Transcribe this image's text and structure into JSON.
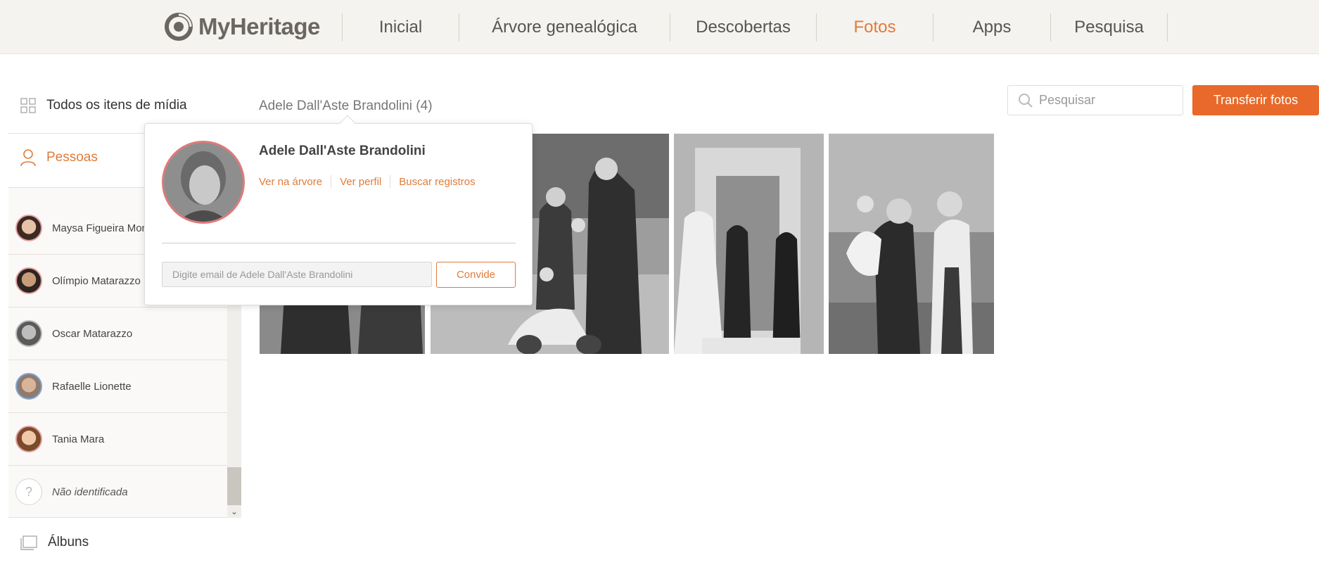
{
  "header": {
    "logo_text": "MyHeritage",
    "nav": [
      {
        "label": "Inicial",
        "active": false
      },
      {
        "label": "Árvore genealógica",
        "active": false
      },
      {
        "label": "Descobertas",
        "active": false
      },
      {
        "label": "Fotos",
        "active": true
      },
      {
        "label": "Apps",
        "active": false
      },
      {
        "label": "Pesquisa",
        "active": false
      }
    ]
  },
  "sidebar": {
    "all_media_label": "Todos os itens de mídia",
    "people_label": "Pessoas",
    "albums_label": "Álbuns",
    "people": [
      {
        "name": "Maysa Figueira Monj"
      },
      {
        "name": "Olímpio Matarazzo"
      },
      {
        "name": "Oscar Matarazzo"
      },
      {
        "name": "Rafaelle Lionette"
      },
      {
        "name": "Tania Mara"
      },
      {
        "name": "Não identificada"
      }
    ]
  },
  "main": {
    "gallery_title": "Adele Dall'Aste Brandolini (4)",
    "search_placeholder": "Pesquisar",
    "upload_label": "Transferir fotos",
    "photos_count": 4
  },
  "popover": {
    "name": "Adele Dall'Aste Brandolini",
    "links": [
      "Ver na árvore",
      "Ver perfil",
      "Buscar registros"
    ],
    "email_placeholder": "Digite email de Adele Dall'Aste Brandolini",
    "invite_label": "Convide"
  },
  "colors": {
    "accent": "#e07b39",
    "button": "#e8692a",
    "header_bg": "#f5f3ef"
  }
}
